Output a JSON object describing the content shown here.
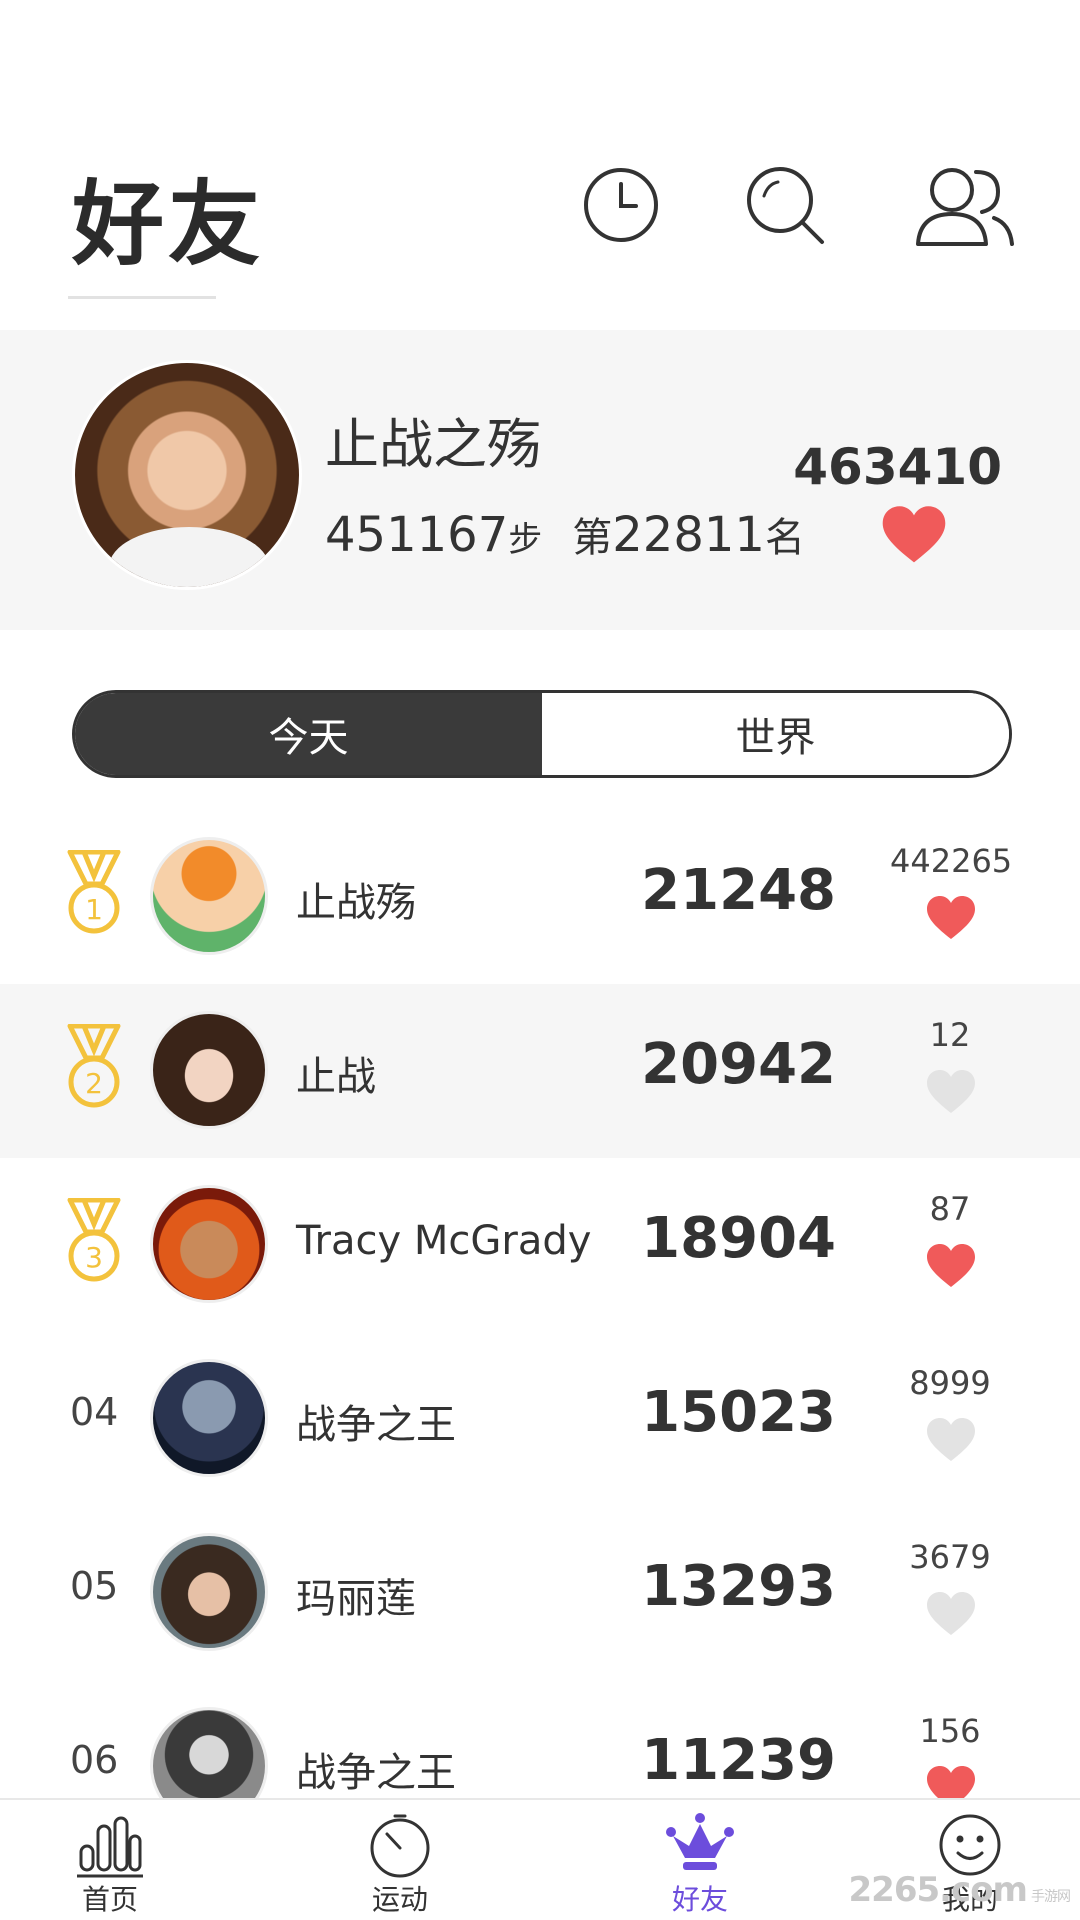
{
  "header": {
    "title": "好友",
    "icons": [
      "clock-icon",
      "search-icon",
      "friends-icon"
    ]
  },
  "profile": {
    "name": "止战之殇",
    "steps": "451167",
    "steps_unit": "步",
    "rank_prefix": "第",
    "rank": "22811",
    "rank_suffix": "名",
    "likes": "463410",
    "liked": true
  },
  "tabs": [
    {
      "label": "今天",
      "active": true
    },
    {
      "label": "世界",
      "active": false
    }
  ],
  "leaderboard": [
    {
      "rank": "1",
      "medal": true,
      "name": "止战殇",
      "steps": "21248",
      "likes": "442265",
      "liked": true
    },
    {
      "rank": "2",
      "medal": true,
      "name": "止战",
      "steps": "20942",
      "likes": "12",
      "liked": false
    },
    {
      "rank": "3",
      "medal": true,
      "name": "Tracy McGrady",
      "steps": "18904",
      "likes": "87",
      "liked": true
    },
    {
      "rank": "04",
      "medal": false,
      "name": "战争之王",
      "steps": "15023",
      "likes": "8999",
      "liked": false
    },
    {
      "rank": "05",
      "medal": false,
      "name": "玛丽莲",
      "steps": "13293",
      "likes": "3679",
      "liked": false
    },
    {
      "rank": "06",
      "medal": false,
      "name": "战争之王",
      "steps": "11239",
      "likes": "156",
      "liked": true
    }
  ],
  "bottom_nav": [
    {
      "label": "首页",
      "icon": "bar-chart-icon",
      "active": false
    },
    {
      "label": "运动",
      "icon": "stopwatch-icon",
      "active": false
    },
    {
      "label": "好友",
      "icon": "crown-icon",
      "active": true
    },
    {
      "label": "我的",
      "icon": "smiley-icon",
      "active": false
    }
  ],
  "watermark": {
    "text": "2265.com",
    "small": "手游网"
  },
  "colors": {
    "heart_active": "#f05a5a",
    "heart_inactive": "#e3e3e3",
    "medal": "#f3c23c",
    "nav_active": "#6c4ddc",
    "toggle_active": "#3a3a3a",
    "row_alt": "#f6f6f6"
  }
}
